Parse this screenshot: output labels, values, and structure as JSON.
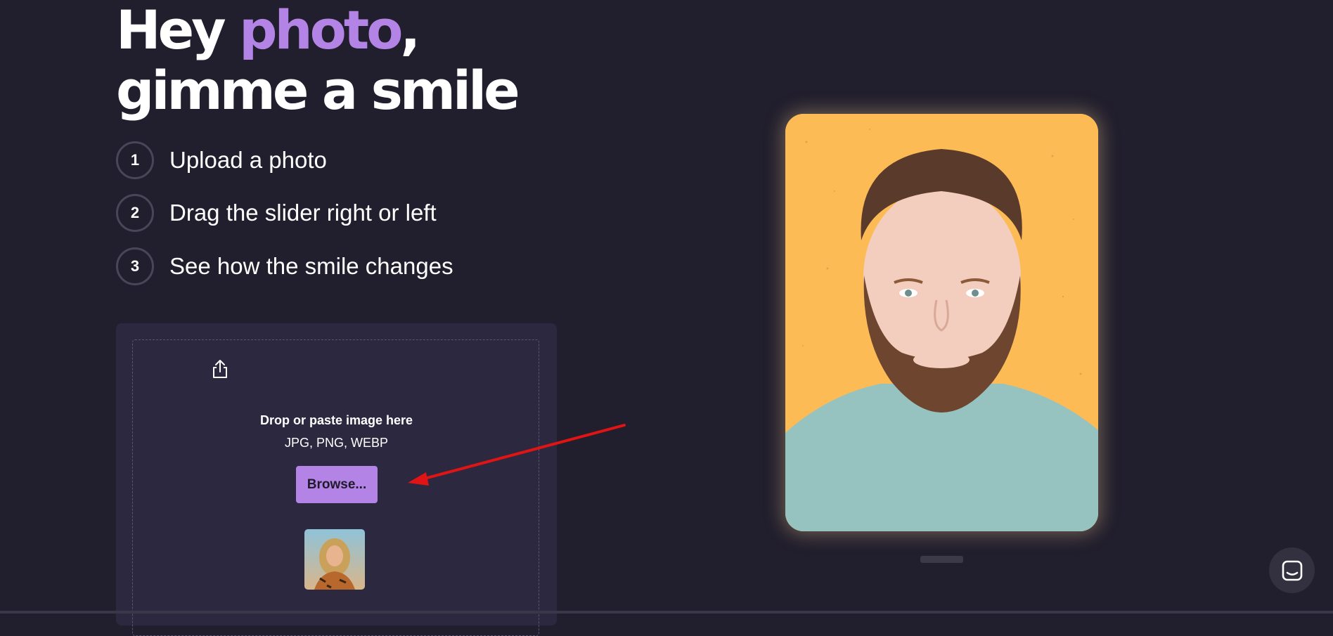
{
  "hero": {
    "headline_pre": "Hey ",
    "headline_accent": "photo",
    "headline_post": ",",
    "headline_line2": "gimme a smile"
  },
  "steps": [
    {
      "num": "1",
      "label": "Upload a photo"
    },
    {
      "num": "2",
      "label": "Drag the slider right or left"
    },
    {
      "num": "3",
      "label": "See how the smile changes"
    }
  ],
  "upload": {
    "icon": "upload-share-icon",
    "title": "Drop or paste image here",
    "formats": "JPG, PNG, WEBP",
    "browse_label": "Browse..."
  },
  "colors": {
    "background": "#211e2d",
    "accent": "#b383e6",
    "card": "#2c2840",
    "photo_background": "#fdbb55",
    "annotation_arrow": "#e01414"
  },
  "chat": {
    "icon": "chat-launcher-icon"
  }
}
